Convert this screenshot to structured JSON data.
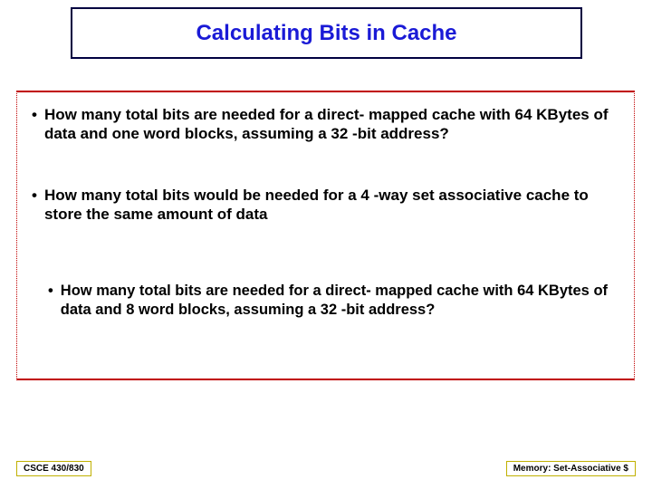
{
  "title": "Calculating Bits in Cache",
  "bullets": {
    "b1": "How many total bits are needed for a direct- mapped cache with 64 KBytes of data and one word blocks, assuming a 32 -bit address?",
    "b2": "How many total bits would be needed for a 4 -way set associative cache to store the same amount of data",
    "b3": "How many total bits are needed for a direct- mapped cache with 64 KBytes of data and 8 word blocks, assuming a 32 -bit address?"
  },
  "footer": {
    "left": "CSCE 430/830",
    "right": "Memory: Set-Associative $"
  }
}
